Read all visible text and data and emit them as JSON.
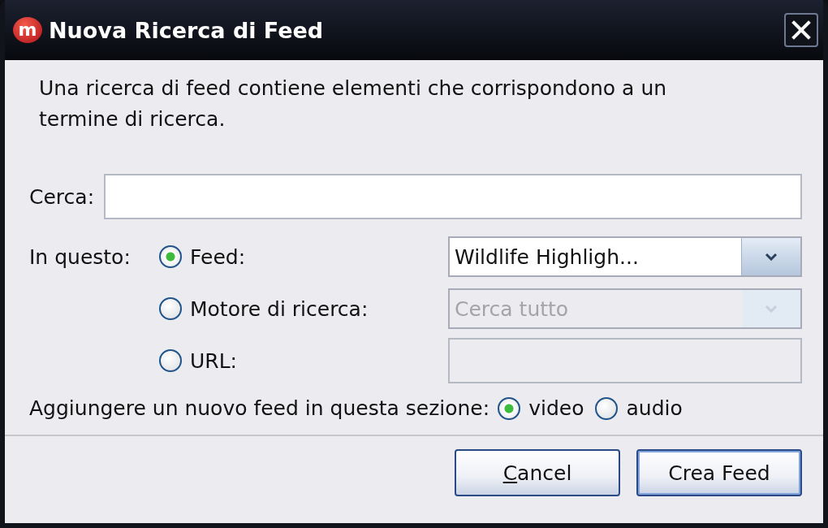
{
  "window": {
    "title": "Nuova Ricerca di Feed",
    "icon_text": "m"
  },
  "description": "Una ricerca di feed contiene elementi che corrispondono a un termine di ricerca.",
  "search": {
    "label": "Cerca:"
  },
  "source": {
    "label": "In questo:",
    "options": [
      {
        "kind": "dropdown",
        "label": "Feed:",
        "selected": true,
        "value": "Wildlife Highligh...",
        "disabled": false
      },
      {
        "kind": "dropdown",
        "label": "Motore di ricerca:",
        "selected": false,
        "value": "Cerca tutto",
        "disabled": true
      },
      {
        "kind": "text",
        "label": "URL:",
        "selected": false,
        "disabled": true
      }
    ]
  },
  "section": {
    "label": "Aggiungere un nuovo feed in questa sezione:",
    "options": [
      {
        "label": "video",
        "selected": true
      },
      {
        "label": "audio",
        "selected": false
      }
    ]
  },
  "buttons": [
    {
      "label": "Cancel",
      "mnemonic": true,
      "default": false
    },
    {
      "label": "Crea Feed",
      "mnemonic": false,
      "default": true
    }
  ]
}
